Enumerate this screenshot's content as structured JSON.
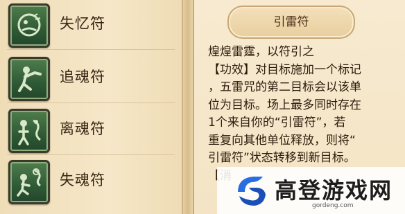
{
  "skills": [
    {
      "label": "失忆符",
      "icon": "amnesia-charm-icon"
    },
    {
      "label": "追魂符",
      "icon": "soul-chase-charm-icon"
    },
    {
      "label": "离魂符",
      "icon": "soul-separation-charm-icon"
    },
    {
      "label": "失魂符",
      "icon": "soul-loss-charm-icon"
    }
  ],
  "detail": {
    "title": "引雷符",
    "lines": [
      "煌煌雷霆，以符引之",
      "【功效】对目标施加一个标记",
      "，五雷咒的第二目标会以该单",
      "位为目标。场上最多同时存在",
      "1个来自你的“引雷符”，若",
      "重复向其他单位释放，则将“",
      "引雷符”状态转移到新目标。",
      "【消"
    ]
  },
  "watermark": {
    "title": "高登游戏网",
    "url": "gordeng.com"
  },
  "colors": {
    "parchment": "#f1e3c4",
    "icon_green": "#2f5a36",
    "text_brown": "#3a2414"
  }
}
